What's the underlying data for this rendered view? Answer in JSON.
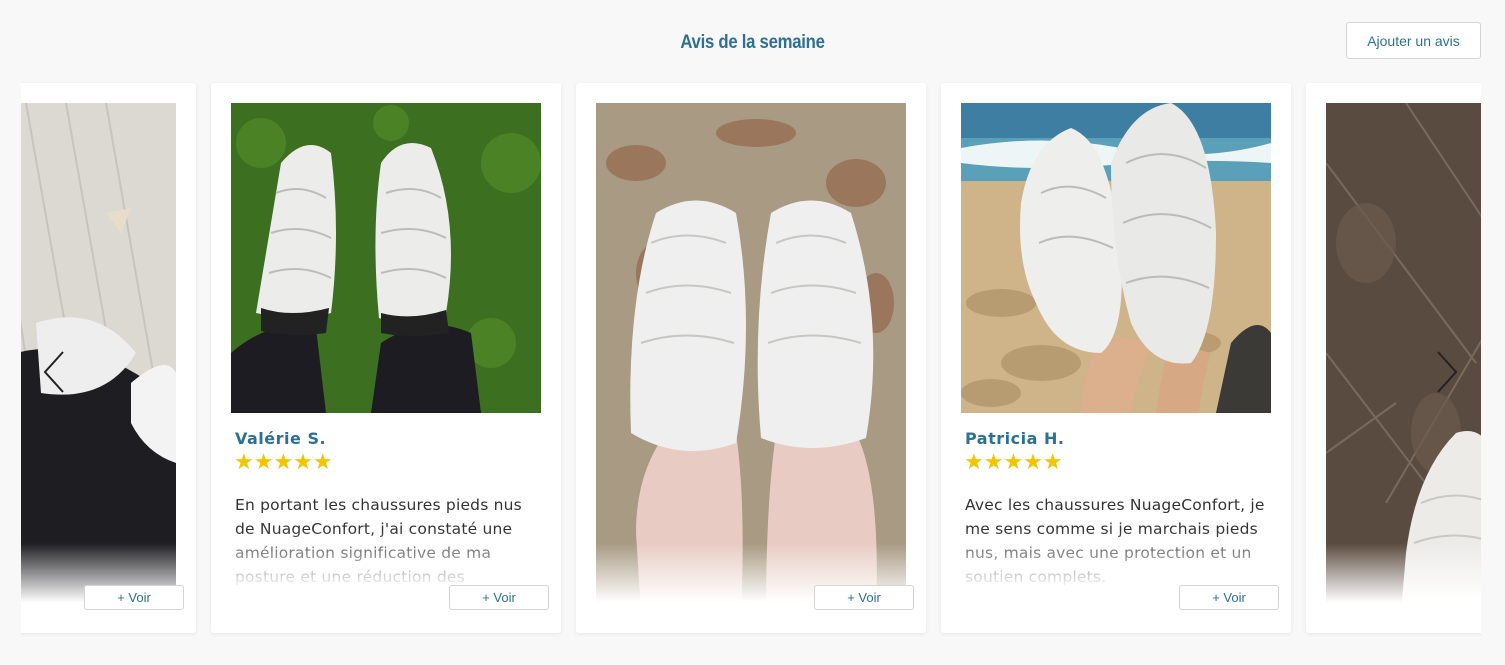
{
  "header": {
    "title": "Avis de la semaine",
    "add_review_label": "Ajouter un avis"
  },
  "carousel": {
    "prev_icon": "chevron-left-icon",
    "next_icon": "chevron-right-icon",
    "cards": [
      {
        "name": "",
        "stars": "",
        "text": "",
        "more_label": "+ Voir",
        "photo": "white-shoes-on-wood-floor"
      },
      {
        "name": "Valérie S.",
        "stars": "★★★★★",
        "text": "En portant les chaussures pieds nus de NuageConfort, j'ai constaté une amélioration significative de ma posture et une réduction des",
        "more_label": "+ Voir",
        "photo": "white-shoes-on-grass"
      },
      {
        "name": "",
        "stars": "",
        "text": "",
        "more_label": "+ Voir",
        "photo": "white-shoes-on-rug"
      },
      {
        "name": "Patricia H.",
        "stars": "★★★★★",
        "text": "Avec les chaussures NuageConfort, je me sens comme si je marchais pieds nus, mais avec une protection et un soutien complets.",
        "more_label": "+ Voir",
        "photo": "white-shoes-on-beach"
      },
      {
        "name": "",
        "stars": "",
        "text": "",
        "more_label": "",
        "photo": "white-shoe-on-tile-floor"
      }
    ]
  },
  "colors": {
    "accent": "#2b7096",
    "star": "#f4c400",
    "background": "#f8f8f8"
  }
}
